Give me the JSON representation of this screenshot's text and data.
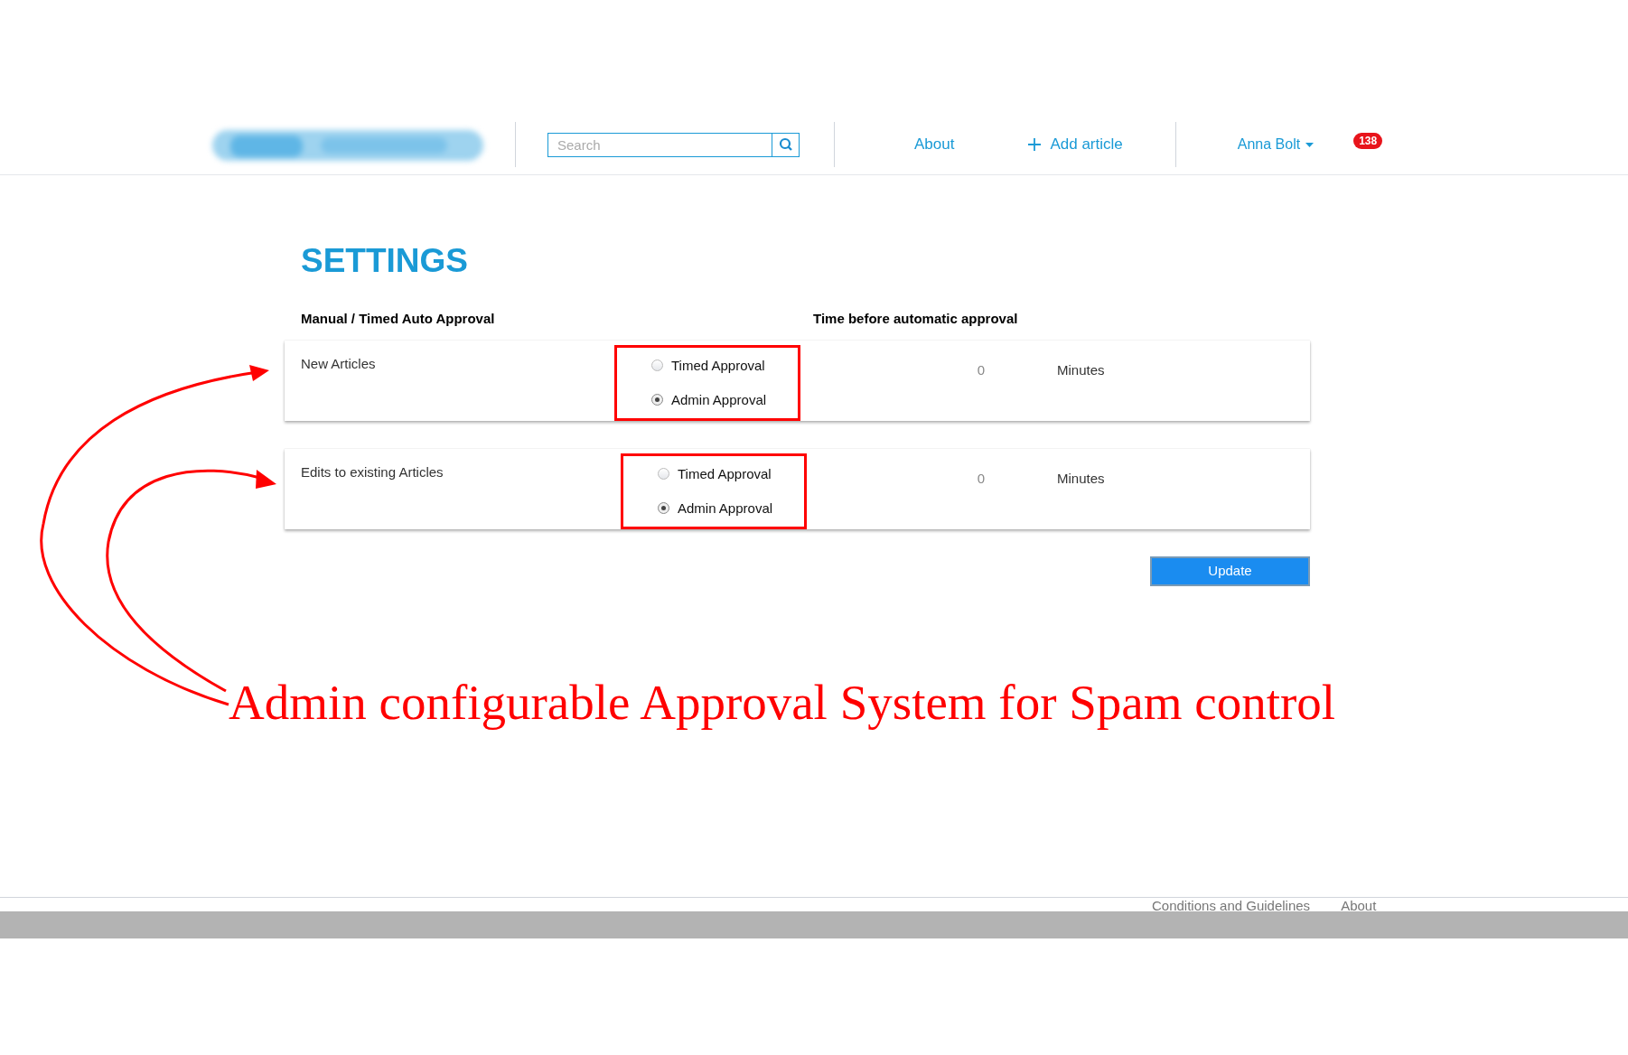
{
  "header": {
    "search": {
      "placeholder": "Search"
    },
    "nav": [
      {
        "label": "About",
        "kind": "link"
      },
      {
        "label": "Add article",
        "kind": "add"
      }
    ],
    "user": "Anna Bolt",
    "badge": "138"
  },
  "settings": {
    "title": "SETTINGS",
    "columns": [
      "Manual / Timed Auto Approval",
      "Time before automatic approval"
    ],
    "rows": [
      {
        "label": "New Articles",
        "highlighted": true,
        "options": [
          {
            "label": "Timed Approval",
            "selected": false
          },
          {
            "label": "Admin Approval",
            "selected": true
          }
        ],
        "value": "0",
        "unit": "Minutes"
      },
      {
        "label": "Edits to existing Articles",
        "highlighted": true,
        "options": [
          {
            "label": "Timed Approval",
            "selected": false
          },
          {
            "label": "Admin Approval",
            "selected": true
          }
        ],
        "value": "0",
        "unit": "Minutes"
      }
    ],
    "button": "Update"
  },
  "annotation": "Admin configurable Approval System for Spam control",
  "footer": [
    "Conditions and Guidelines",
    "About"
  ]
}
